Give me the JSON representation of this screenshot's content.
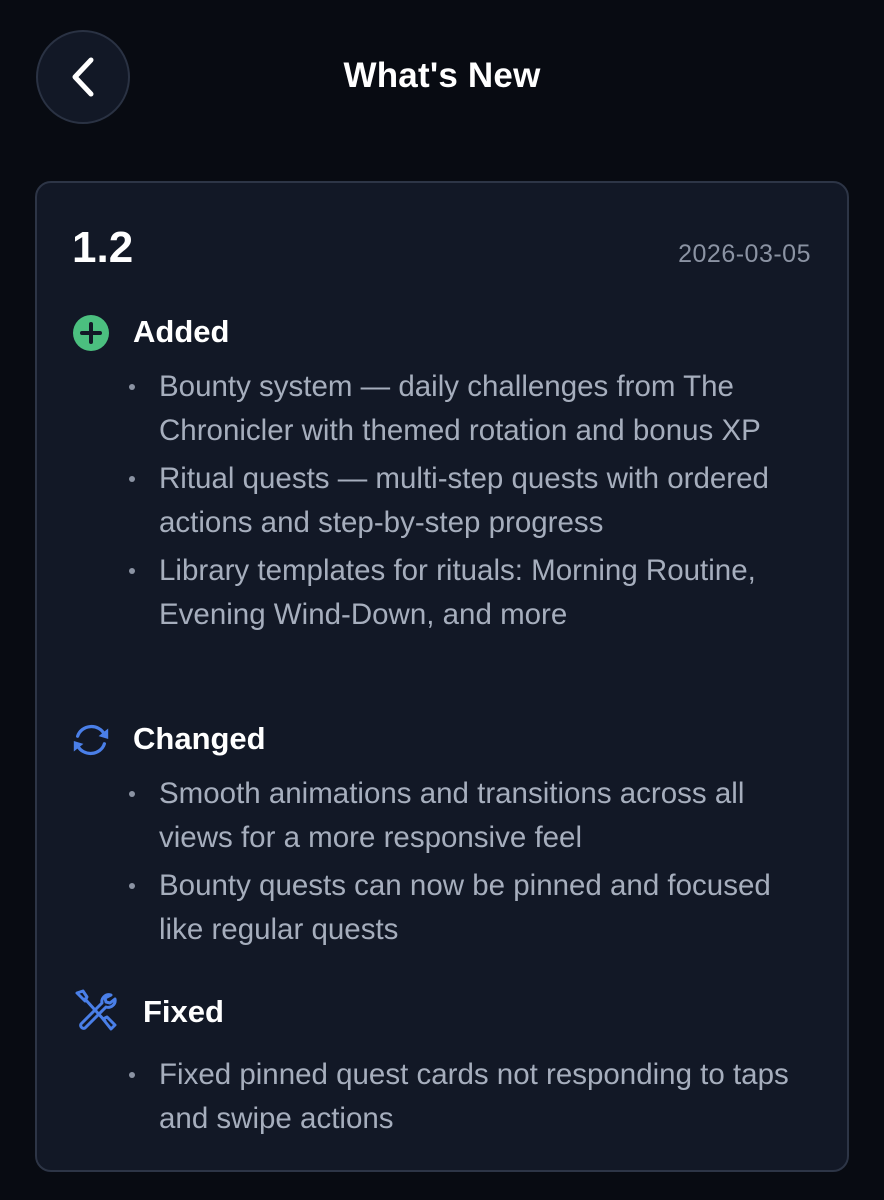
{
  "header": {
    "title": "What's New",
    "back_icon": "chevron-left-icon"
  },
  "release": {
    "version": "1.2",
    "date": "2026-03-05",
    "sections": {
      "added": {
        "title": "Added",
        "icon": "plus-circle-icon",
        "color": "#4bbf7f",
        "items": [
          "Bounty system — daily challenges from The Chronicler with themed rotation and bonus XP",
          "Ritual quests — multi-step quests with ordered actions and step-by-step progress",
          "Library templates for rituals: Morning Routine, Evening Wind-Down, and more"
        ]
      },
      "changed": {
        "title": "Changed",
        "icon": "refresh-icon",
        "color": "#4a7fe8",
        "items": [
          "Smooth animations and transitions across all views for a more responsive feel",
          "Bounty quests can now be pinned and focused like regular quests"
        ]
      },
      "fixed": {
        "title": "Fixed",
        "icon": "wrench-screwdriver-icon",
        "color": "#4a7fe8",
        "items": [
          "Fixed pinned quest cards not responding to taps and swipe actions"
        ]
      }
    }
  }
}
